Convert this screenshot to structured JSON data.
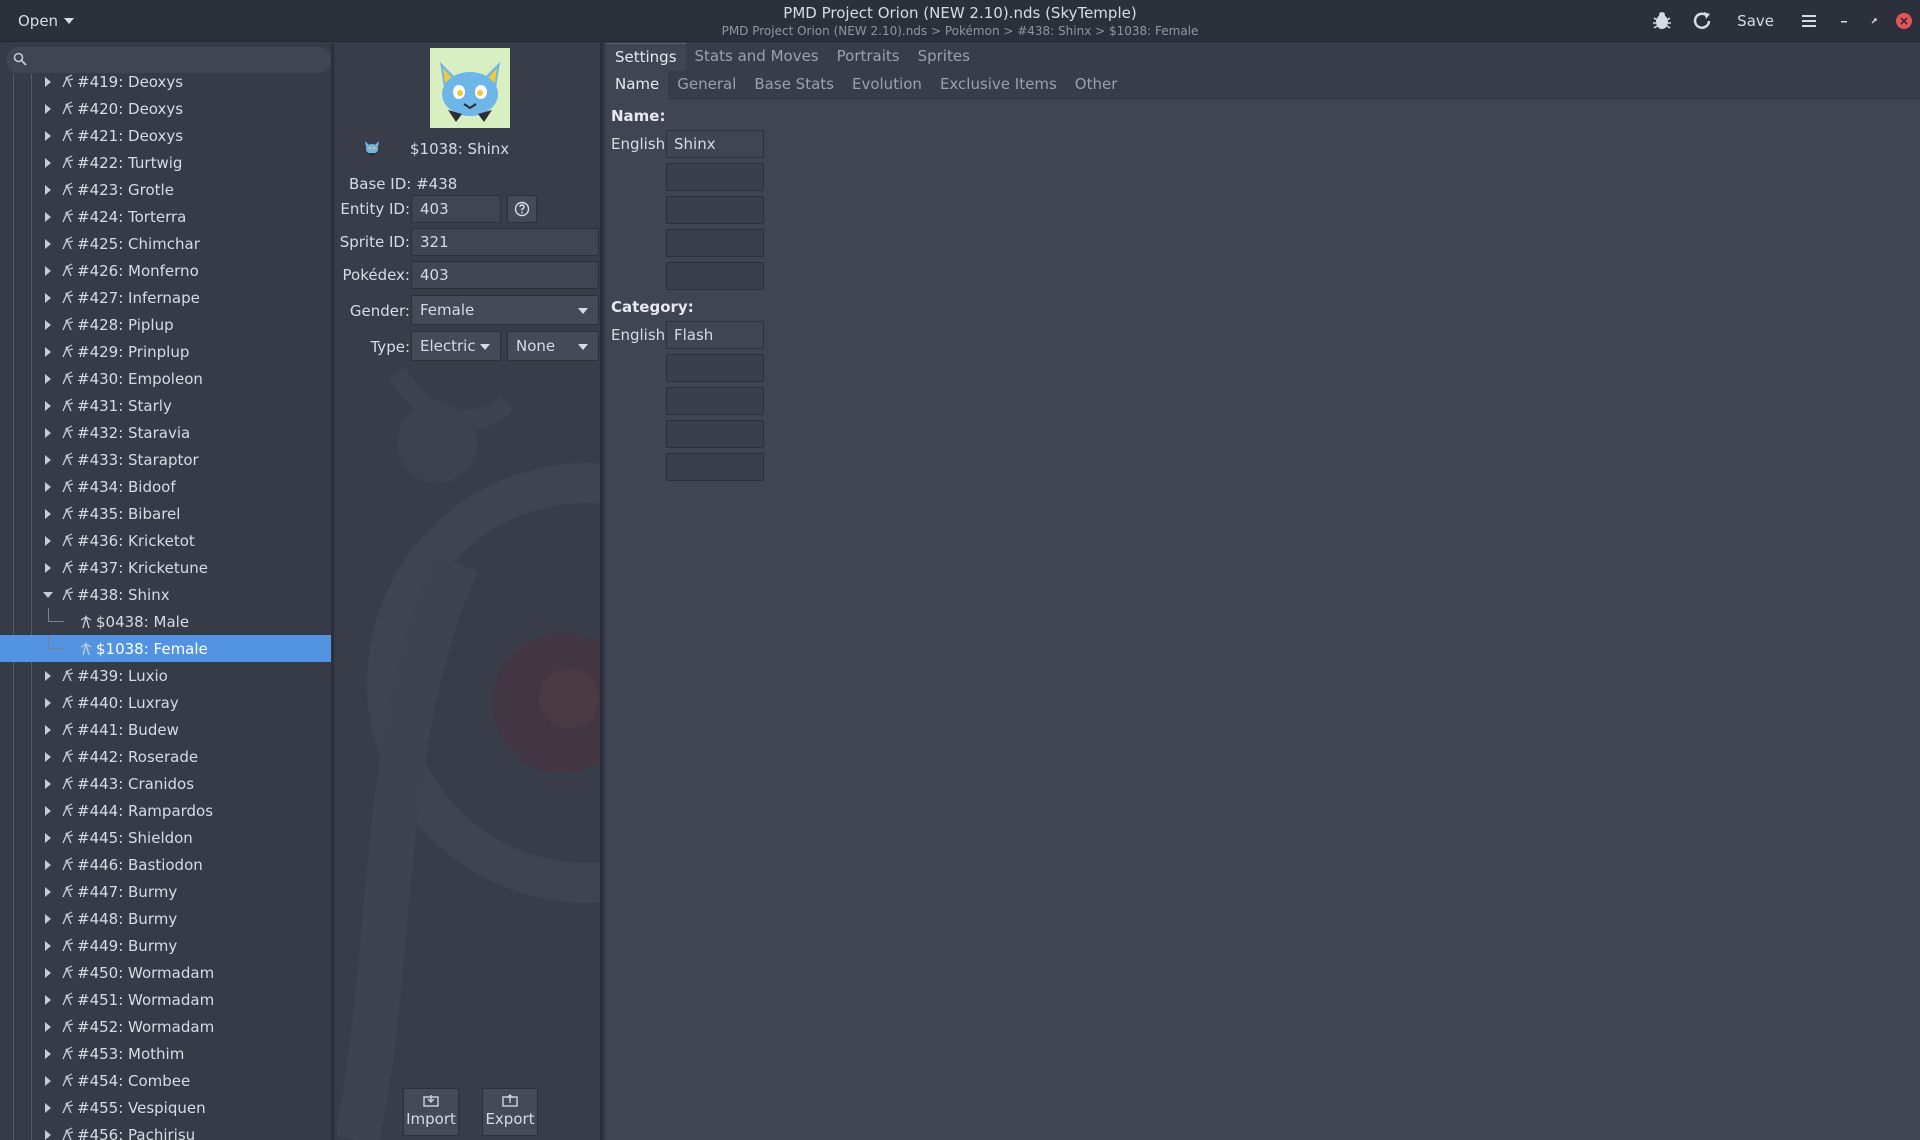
{
  "titlebar": {
    "open_label": "Open",
    "title": "PMD Project Orion (NEW 2.10).nds (SkyTemple)",
    "breadcrumb": "PMD Project Orion (NEW 2.10).nds > Pokémon > #438: Shinx > $1038: Female",
    "save_label": "Save"
  },
  "search": {
    "placeholder": ""
  },
  "tree": {
    "items": [
      {
        "label": "#419: Deoxys"
      },
      {
        "label": "#420: Deoxys"
      },
      {
        "label": "#421: Deoxys"
      },
      {
        "label": "#422: Turtwig"
      },
      {
        "label": "#423: Grotle"
      },
      {
        "label": "#424: Torterra"
      },
      {
        "label": "#425: Chimchar"
      },
      {
        "label": "#426: Monferno"
      },
      {
        "label": "#427: Infernape"
      },
      {
        "label": "#428: Piplup"
      },
      {
        "label": "#429: Prinplup"
      },
      {
        "label": "#430: Empoleon"
      },
      {
        "label": "#431: Starly"
      },
      {
        "label": "#432: Staravia"
      },
      {
        "label": "#433: Staraptor"
      },
      {
        "label": "#434: Bidoof"
      },
      {
        "label": "#435: Bibarel"
      },
      {
        "label": "#436: Kricketot"
      },
      {
        "label": "#437: Kricketune"
      },
      {
        "label": "#438: Shinx"
      },
      {
        "label": "$0438: Male"
      },
      {
        "label": "$1038: Female"
      },
      {
        "label": "#439: Luxio"
      },
      {
        "label": "#440: Luxray"
      },
      {
        "label": "#441: Budew"
      },
      {
        "label": "#442: Roserade"
      },
      {
        "label": "#443: Cranidos"
      },
      {
        "label": "#444: Rampardos"
      },
      {
        "label": "#445: Shieldon"
      },
      {
        "label": "#446: Bastiodon"
      },
      {
        "label": "#447: Burmy"
      },
      {
        "label": "#448: Burmy"
      },
      {
        "label": "#449: Burmy"
      },
      {
        "label": "#450: Wormadam"
      },
      {
        "label": "#451: Wormadam"
      },
      {
        "label": "#452: Wormadam"
      },
      {
        "label": "#453: Mothim"
      },
      {
        "label": "#454: Combee"
      },
      {
        "label": "#455: Vespiquen"
      },
      {
        "label": "#456: Pachirisu"
      }
    ]
  },
  "entity": {
    "name": "$1038: Shinx",
    "base_id": "Base ID: #438",
    "entity_id_label": "Entity ID:",
    "entity_id": "403",
    "sprite_id_label": "Sprite ID:",
    "sprite_id": "321",
    "pokedex_label": "Pokédex:",
    "pokedex": "403",
    "gender_label": "Gender:",
    "gender": "Female",
    "type_label": "Type:",
    "type1": "Electric",
    "type2": "None",
    "import_label": "Import",
    "export_label": "Export"
  },
  "tabs_main": [
    "Settings",
    "Stats and Moves",
    "Portraits",
    "Sprites"
  ],
  "tabs_sub": [
    "Name",
    "General",
    "Base Stats",
    "Evolution",
    "Exclusive Items",
    "Other"
  ],
  "name_section": {
    "heading": "Name:",
    "english_label": "English:",
    "english_value": "Shinx"
  },
  "category_section": {
    "heading": "Category:",
    "english_label": "English:",
    "english_value": "Flash"
  },
  "colors": {
    "accent": "#5294e2",
    "close": "#e0555a"
  }
}
